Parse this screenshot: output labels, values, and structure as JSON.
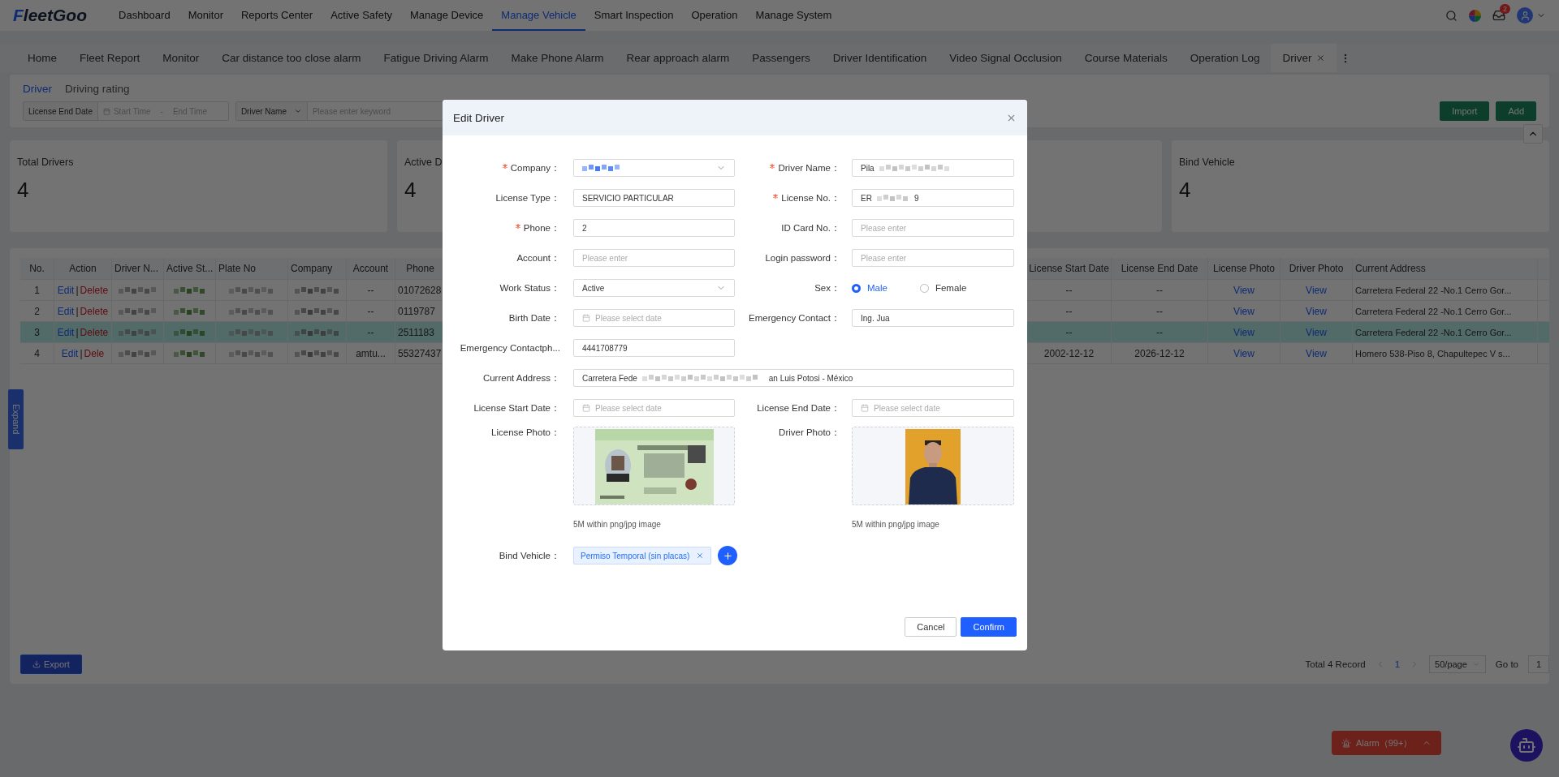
{
  "nav": {
    "logo": "FleetGoo",
    "inbox_badge": "2",
    "menu": [
      {
        "label": "Dashboard",
        "selected": false
      },
      {
        "label": "Monitor",
        "selected": false
      },
      {
        "label": "Reports Center",
        "selected": false
      },
      {
        "label": "Active Safety",
        "selected": false
      },
      {
        "label": "Manage Device",
        "selected": false
      },
      {
        "label": "Manage Vehicle",
        "selected": true
      },
      {
        "label": "Smart Inspection",
        "selected": false
      },
      {
        "label": "Operation",
        "selected": false
      },
      {
        "label": "Manage System",
        "selected": false
      }
    ]
  },
  "tabs": [
    {
      "label": "Home",
      "selected": false
    },
    {
      "label": "Fleet Report",
      "selected": false
    },
    {
      "label": "Monitor",
      "selected": false
    },
    {
      "label": "Car distance too close alarm",
      "selected": false
    },
    {
      "label": "Fatigue Driving Alarm",
      "selected": false
    },
    {
      "label": "Make Phone Alarm",
      "selected": false
    },
    {
      "label": "Rear approach alarm",
      "selected": false
    },
    {
      "label": "Passengers",
      "selected": false
    },
    {
      "label": "Driver Identification",
      "selected": false
    },
    {
      "label": "Video Signal Occlusion",
      "selected": false
    },
    {
      "label": "Course Materials",
      "selected": false
    },
    {
      "label": "Operation Log",
      "selected": false
    },
    {
      "label": "Driver",
      "selected": true
    }
  ],
  "subtabs": [
    {
      "label": "Driver",
      "selected": true
    },
    {
      "label": "Driving rating",
      "selected": false
    }
  ],
  "filters": {
    "date_select": "License End Date",
    "start_placeholder": "Start Time",
    "separator": "-",
    "end_placeholder": "End Time",
    "name_select": "Driver Name",
    "keyword_placeholder": "Please enter keyword"
  },
  "actions": [
    "Import",
    "Add"
  ],
  "stats": [
    {
      "kind": "stat",
      "title": "Total Drivers",
      "value": "4"
    },
    {
      "kind": "stat",
      "title": "Active D",
      "value": "4"
    },
    {
      "kind": "covered"
    },
    {
      "kind": "stat",
      "title": "Bind Vehicle",
      "value": "4"
    }
  ],
  "table": {
    "action_separator": "|",
    "columns": [
      "No.",
      "Action",
      "Driver N...",
      "Active St...",
      "Plate No",
      "Company",
      "Account",
      "Phone",
      "License Start Date",
      "License End Date",
      "License Photo",
      "Driver Photo",
      "Current Address"
    ],
    "rows": [
      {
        "no": "1",
        "edit": "Edit",
        "delete": "Delete",
        "account": "--",
        "phone": "01072628",
        "license_start": "--",
        "license_end": "--",
        "license_photo": "View",
        "driver_photo": "View",
        "address": "Carretera Federal 22 -No.1 Cerro Gor...",
        "selected": false
      },
      {
        "no": "2",
        "edit": "Edit",
        "delete": "Delete",
        "account": "--",
        "phone": "0119787",
        "license_start": "--",
        "license_end": "--",
        "license_photo": "View",
        "driver_photo": "View",
        "address": "Carretera Federal 22 -No.1 Cerro Gor...",
        "selected": false
      },
      {
        "no": "3",
        "edit": "Edit",
        "delete": "Delete",
        "account": "--",
        "phone": "2511183",
        "license_start": "--",
        "license_end": "--",
        "license_photo": "View",
        "driver_photo": "View",
        "address": "Carretera Federal 22 -No.1 Cerro Gor...",
        "selected": true
      },
      {
        "no": "4",
        "edit": "Edit",
        "delete": "Dele",
        "account": "amtu...",
        "phone": "55327437",
        "license_start": "2002-12-12",
        "license_end": "2026-12-12",
        "license_photo": "View",
        "driver_photo": "View",
        "address": "Homero 538-Piso 8, Chapultepec V s...",
        "selected": false
      }
    ]
  },
  "export": "Export",
  "pagination": {
    "total": "Total 4 Record",
    "page": "1",
    "page_size": "50/page",
    "goto_label": "Go to",
    "goto_value": "1"
  },
  "expand": "Expand",
  "alarm": "Alarm（99+）",
  "modal": {
    "title": "Edit Driver",
    "rows": [
      {
        "left": {
          "label": "Company：",
          "kind": "select",
          "required": true
        },
        "right": {
          "label": "Driver Name：",
          "kind": "input",
          "required": true,
          "value": "Pila"
        }
      },
      {
        "left": {
          "label": "License Type：",
          "kind": "input",
          "required": false,
          "value": "SERVICIO PARTICULAR"
        },
        "right": {
          "label": "License No.：",
          "kind": "input",
          "required": true,
          "value": "ER",
          "value_end": "9"
        }
      },
      {
        "left": {
          "label": "Phone：",
          "kind": "input",
          "required": true,
          "value": "2"
        },
        "right": {
          "label": "ID Card No.：",
          "kind": "input",
          "required": false,
          "placeholder": "Please enter"
        }
      },
      {
        "left": {
          "label": "Account：",
          "kind": "input",
          "required": false,
          "placeholder": "Please enter"
        },
        "right": {
          "label": "Login password：",
          "kind": "input",
          "required": false,
          "placeholder": "Please enter"
        }
      },
      {
        "left": {
          "label": "Work Status：",
          "kind": "select",
          "required": false,
          "value": "Active"
        },
        "right": {
          "label": "Sex：",
          "kind": "radio",
          "required": false,
          "options": [
            {
              "label": "Male",
              "selected": true
            },
            {
              "label": "Female",
              "selected": false
            }
          ]
        }
      },
      {
        "left": {
          "label": "Birth Date：",
          "kind": "date",
          "required": false,
          "placeholder": "Please select date"
        },
        "right": {
          "label": "Emergency Contact：",
          "kind": "input",
          "required": false,
          "value": "Ing. Jua"
        }
      },
      {
        "left": {
          "label": "Emergency Contactph...",
          "kind": "input",
          "required": false,
          "value": "4441708779"
        }
      },
      {
        "wide": {
          "label": "Current Address：",
          "kind": "input",
          "required": false,
          "value": "Carretera Fede",
          "value_end": "an Luis Potosi - México"
        }
      },
      {
        "left": {
          "label": "License Start Date：",
          "kind": "date",
          "required": false,
          "placeholder": "Please select date"
        },
        "right": {
          "label": "License End Date：",
          "kind": "date",
          "required": false,
          "placeholder": "Please select date"
        }
      },
      {
        "left": {
          "label": "License Photo：",
          "required": false,
          "hint": "5M within png/jpg image"
        },
        "right": {
          "label": "Driver Photo：",
          "required": false,
          "hint": "5M within png/jpg image"
        }
      },
      {
        "left": {
          "label": "Bind Vehicle：",
          "kind": "tags",
          "required": false,
          "tags": [
            "Permiso Temporal (sin placas)"
          ]
        }
      }
    ],
    "buttons": [
      {
        "label": "Cancel",
        "kind": "secondary"
      },
      {
        "label": "Confirm",
        "kind": "primary"
      }
    ]
  }
}
